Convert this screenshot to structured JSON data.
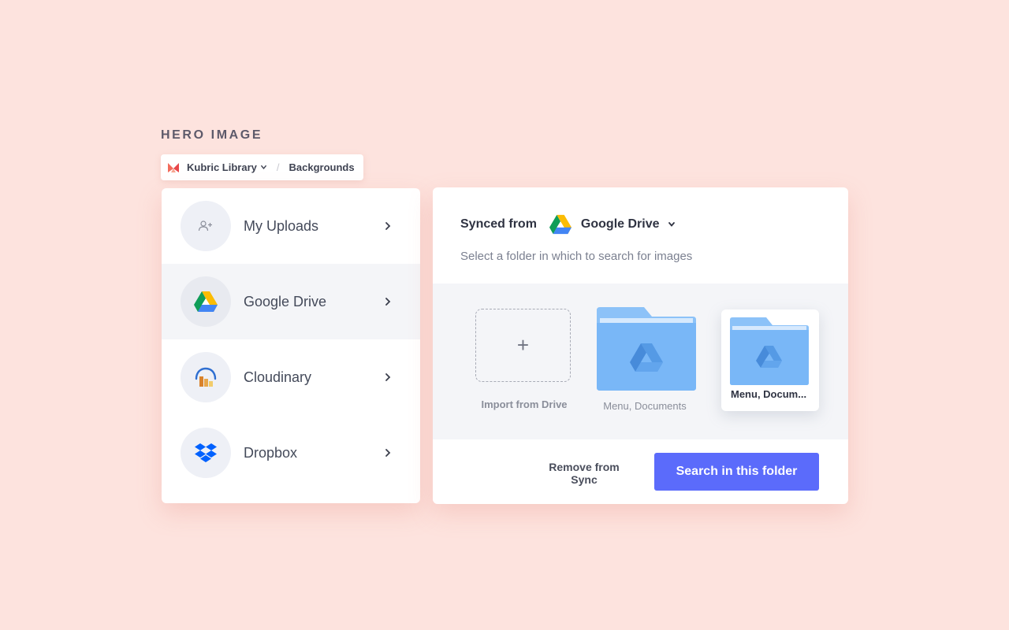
{
  "section": {
    "title": "HERO IMAGE"
  },
  "breadcrumb": {
    "library": "Kubric Library",
    "separator": "/",
    "current": "Backgrounds"
  },
  "sources": [
    {
      "label": "My Uploads",
      "icon": "add-user-icon",
      "active": false
    },
    {
      "label": "Google Drive",
      "icon": "google-drive-icon",
      "active": true
    },
    {
      "label": "Cloudinary",
      "icon": "cloudinary-icon",
      "active": false
    },
    {
      "label": "Dropbox",
      "icon": "dropbox-icon",
      "active": false
    }
  ],
  "sync": {
    "synced_from": "Synced from",
    "provider": "Google Drive",
    "hint": "Select a folder in which to search for images"
  },
  "folders": {
    "import_symbol": "+",
    "import_label": "Import from Drive",
    "items": [
      {
        "label": "Menu, Documents",
        "selected": false
      },
      {
        "label": "Menu, Docum...",
        "selected": true
      }
    ]
  },
  "actions": {
    "remove_label": "Remove from Sync",
    "search_label": "Search in this folder"
  },
  "colors": {
    "background": "#fde3de",
    "accent": "#5b6bfb",
    "folder": "#79b7f7"
  }
}
